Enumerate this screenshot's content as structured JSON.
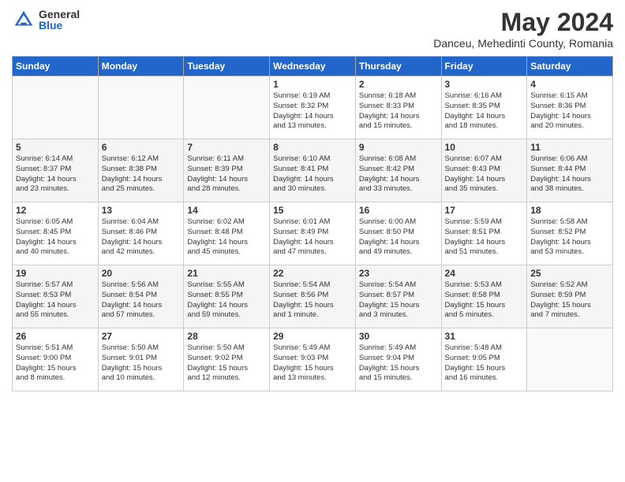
{
  "header": {
    "logo": {
      "general": "General",
      "blue": "Blue"
    },
    "title": "May 2024",
    "subtitle": "Danceu, Mehedinti County, Romania"
  },
  "days_of_week": [
    "Sunday",
    "Monday",
    "Tuesday",
    "Wednesday",
    "Thursday",
    "Friday",
    "Saturday"
  ],
  "weeks": [
    [
      {
        "day": "",
        "info": ""
      },
      {
        "day": "",
        "info": ""
      },
      {
        "day": "",
        "info": ""
      },
      {
        "day": "1",
        "info": "Sunrise: 6:19 AM\nSunset: 8:32 PM\nDaylight: 14 hours\nand 13 minutes."
      },
      {
        "day": "2",
        "info": "Sunrise: 6:18 AM\nSunset: 8:33 PM\nDaylight: 14 hours\nand 15 minutes."
      },
      {
        "day": "3",
        "info": "Sunrise: 6:16 AM\nSunset: 8:35 PM\nDaylight: 14 hours\nand 18 minutes."
      },
      {
        "day": "4",
        "info": "Sunrise: 6:15 AM\nSunset: 8:36 PM\nDaylight: 14 hours\nand 20 minutes."
      }
    ],
    [
      {
        "day": "5",
        "info": "Sunrise: 6:14 AM\nSunset: 8:37 PM\nDaylight: 14 hours\nand 23 minutes."
      },
      {
        "day": "6",
        "info": "Sunrise: 6:12 AM\nSunset: 8:38 PM\nDaylight: 14 hours\nand 25 minutes."
      },
      {
        "day": "7",
        "info": "Sunrise: 6:11 AM\nSunset: 8:39 PM\nDaylight: 14 hours\nand 28 minutes."
      },
      {
        "day": "8",
        "info": "Sunrise: 6:10 AM\nSunset: 8:41 PM\nDaylight: 14 hours\nand 30 minutes."
      },
      {
        "day": "9",
        "info": "Sunrise: 6:08 AM\nSunset: 8:42 PM\nDaylight: 14 hours\nand 33 minutes."
      },
      {
        "day": "10",
        "info": "Sunrise: 6:07 AM\nSunset: 8:43 PM\nDaylight: 14 hours\nand 35 minutes."
      },
      {
        "day": "11",
        "info": "Sunrise: 6:06 AM\nSunset: 8:44 PM\nDaylight: 14 hours\nand 38 minutes."
      }
    ],
    [
      {
        "day": "12",
        "info": "Sunrise: 6:05 AM\nSunset: 8:45 PM\nDaylight: 14 hours\nand 40 minutes."
      },
      {
        "day": "13",
        "info": "Sunrise: 6:04 AM\nSunset: 8:46 PM\nDaylight: 14 hours\nand 42 minutes."
      },
      {
        "day": "14",
        "info": "Sunrise: 6:02 AM\nSunset: 8:48 PM\nDaylight: 14 hours\nand 45 minutes."
      },
      {
        "day": "15",
        "info": "Sunrise: 6:01 AM\nSunset: 8:49 PM\nDaylight: 14 hours\nand 47 minutes."
      },
      {
        "day": "16",
        "info": "Sunrise: 6:00 AM\nSunset: 8:50 PM\nDaylight: 14 hours\nand 49 minutes."
      },
      {
        "day": "17",
        "info": "Sunrise: 5:59 AM\nSunset: 8:51 PM\nDaylight: 14 hours\nand 51 minutes."
      },
      {
        "day": "18",
        "info": "Sunrise: 5:58 AM\nSunset: 8:52 PM\nDaylight: 14 hours\nand 53 minutes."
      }
    ],
    [
      {
        "day": "19",
        "info": "Sunrise: 5:57 AM\nSunset: 8:53 PM\nDaylight: 14 hours\nand 55 minutes."
      },
      {
        "day": "20",
        "info": "Sunrise: 5:56 AM\nSunset: 8:54 PM\nDaylight: 14 hours\nand 57 minutes."
      },
      {
        "day": "21",
        "info": "Sunrise: 5:55 AM\nSunset: 8:55 PM\nDaylight: 14 hours\nand 59 minutes."
      },
      {
        "day": "22",
        "info": "Sunrise: 5:54 AM\nSunset: 8:56 PM\nDaylight: 15 hours\nand 1 minute."
      },
      {
        "day": "23",
        "info": "Sunrise: 5:54 AM\nSunset: 8:57 PM\nDaylight: 15 hours\nand 3 minutes."
      },
      {
        "day": "24",
        "info": "Sunrise: 5:53 AM\nSunset: 8:58 PM\nDaylight: 15 hours\nand 5 minutes."
      },
      {
        "day": "25",
        "info": "Sunrise: 5:52 AM\nSunset: 8:59 PM\nDaylight: 15 hours\nand 7 minutes."
      }
    ],
    [
      {
        "day": "26",
        "info": "Sunrise: 5:51 AM\nSunset: 9:00 PM\nDaylight: 15 hours\nand 8 minutes."
      },
      {
        "day": "27",
        "info": "Sunrise: 5:50 AM\nSunset: 9:01 PM\nDaylight: 15 hours\nand 10 minutes."
      },
      {
        "day": "28",
        "info": "Sunrise: 5:50 AM\nSunset: 9:02 PM\nDaylight: 15 hours\nand 12 minutes."
      },
      {
        "day": "29",
        "info": "Sunrise: 5:49 AM\nSunset: 9:03 PM\nDaylight: 15 hours\nand 13 minutes."
      },
      {
        "day": "30",
        "info": "Sunrise: 5:49 AM\nSunset: 9:04 PM\nDaylight: 15 hours\nand 15 minutes."
      },
      {
        "day": "31",
        "info": "Sunrise: 5:48 AM\nSunset: 9:05 PM\nDaylight: 15 hours\nand 16 minutes."
      },
      {
        "day": "",
        "info": ""
      }
    ]
  ]
}
